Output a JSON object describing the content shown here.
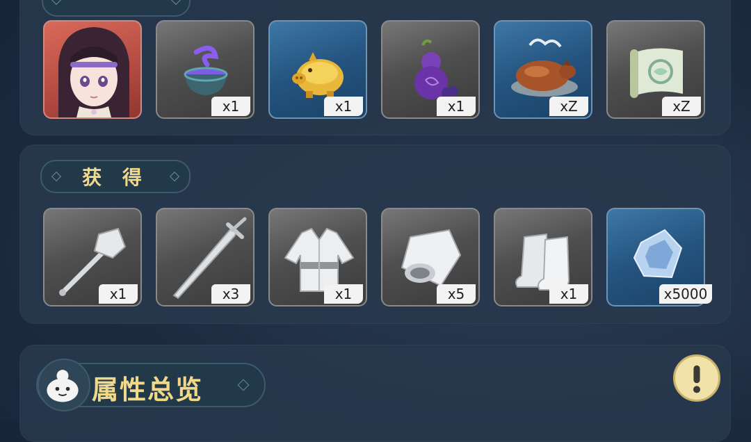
{
  "sections": {
    "top_tab_label": "",
    "mid_tab_label": "获 得",
    "attr_title": "属性总览"
  },
  "top_items": [
    {
      "name": "character-portrait",
      "count": ""
    },
    {
      "name": "purple-potion-bowl",
      "count": "x1"
    },
    {
      "name": "golden-piggy-bank",
      "count": "x1"
    },
    {
      "name": "purple-gourd",
      "count": "x1"
    },
    {
      "name": "roast-pig",
      "count": "xZ"
    },
    {
      "name": "jade-scroll",
      "count": "xZ"
    }
  ],
  "mid_items": [
    {
      "name": "iron-mace",
      "count": "x1"
    },
    {
      "name": "iron-sword",
      "count": "x3"
    },
    {
      "name": "white-robe",
      "count": "x1"
    },
    {
      "name": "white-bracer",
      "count": "x5"
    },
    {
      "name": "white-boots",
      "count": "x1"
    },
    {
      "name": "blue-crystal",
      "count": "x5000"
    }
  ],
  "colors": {
    "accent_text": "#f2d98a",
    "panel": "#28384e",
    "slot_grey": "#4f4f4f",
    "slot_blue": "#24547f",
    "slot_red": "#b34a41"
  },
  "icons": [
    "mascot-icon",
    "exclamation-icon",
    "diamond-ornament-icon"
  ]
}
